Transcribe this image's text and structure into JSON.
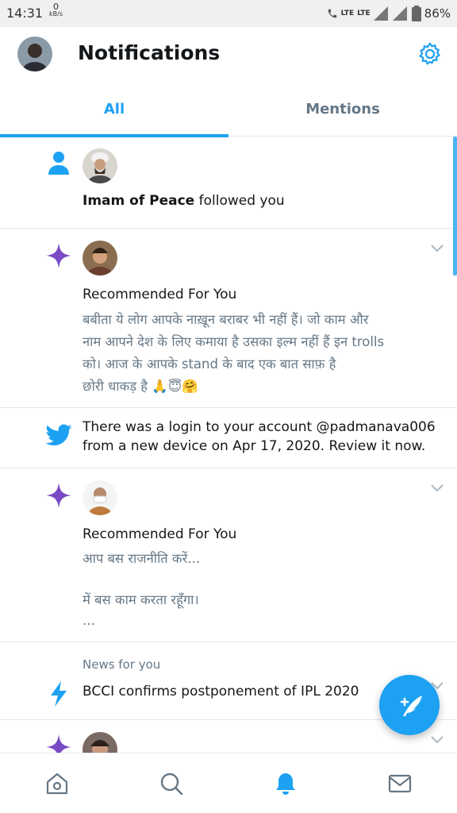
{
  "status_bar": {
    "time": "14:31",
    "speed_value": "0",
    "speed_unit": "kB/s",
    "network": "LTE",
    "network2": "LTE",
    "battery": "86%"
  },
  "header": {
    "title": "Notifications",
    "settings_icon": "gear-icon"
  },
  "tabs": [
    {
      "label": "All",
      "selected": true
    },
    {
      "label": "Mentions",
      "selected": false
    }
  ],
  "notifications": [
    {
      "type": "follow",
      "icon": "person-icon",
      "user": "Imam of Peace",
      "action": " followed you"
    },
    {
      "type": "recommended",
      "icon": "sparkle-icon",
      "heading": "Recommended For You",
      "body_lines": [
        "बबीता ये लोग आपके नाख़ून बराबर भी नहीं हैं। जो काम और",
        "नाम आपने देश के लिए कमाया है उसका इल्म नहीं हैं इन trolls",
        "को। आज के आपके stand के बाद एक बात साफ़ है",
        "छोरी धाकड़ है 🙏😇🤗"
      ]
    },
    {
      "type": "security",
      "icon": "twitter-bird-icon",
      "body_lines": [
        "There was a login to your account @padmanava006",
        "from a new device on Apr 17, 2020. Review it now."
      ]
    },
    {
      "type": "recommended",
      "icon": "sparkle-icon",
      "heading": "Recommended For You",
      "body_lines": [
        "आप बस राजनीति करें...",
        "",
        "में बस काम करता रहूँगा।",
        "..."
      ]
    },
    {
      "type": "news",
      "icon": "lightning-icon",
      "label": "News for you",
      "headline": "BCCI confirms postponement of IPL 2020"
    },
    {
      "type": "recommended",
      "icon": "sparkle-icon"
    }
  ],
  "fab": {
    "icon": "compose-tweet-icon"
  },
  "bottom_nav": [
    {
      "icon": "home-icon",
      "active": false
    },
    {
      "icon": "search-icon",
      "active": false
    },
    {
      "icon": "bell-icon",
      "active": true
    },
    {
      "icon": "mail-icon",
      "active": false
    }
  ],
  "colors": {
    "accent": "#1da1f2",
    "sparkle": "#794bc4",
    "muted": "#657786",
    "text": "#14171a"
  }
}
